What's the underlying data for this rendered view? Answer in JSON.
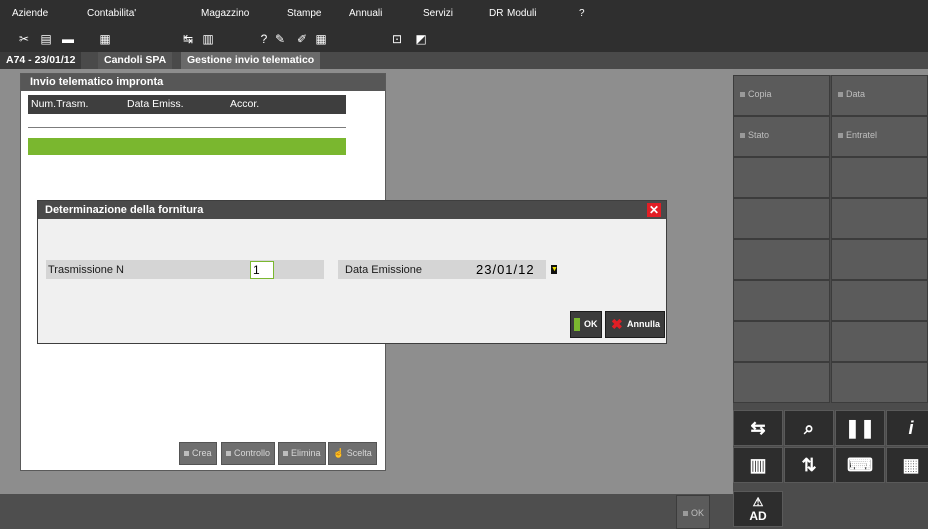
{
  "menu": {
    "items": [
      "Aziende",
      "Contabilita'",
      "Magazzino",
      "Stampe",
      "Annuali",
      "Servizi",
      "DR",
      "Moduli",
      "?"
    ]
  },
  "toolbar": {
    "icons": [
      "scissors-icon",
      "document-icon",
      "folder-icon",
      "printer-icon",
      "transfer-icon",
      "calendar-icon",
      "help-icon",
      "link-icon",
      "pencil-icon",
      "calculator-icon",
      "select-icon",
      "frame-icon"
    ]
  },
  "tabs": {
    "context": "A74 - 23/01/12",
    "company": "Candoli SPA",
    "module": "Gestione invio telematico"
  },
  "left_window": {
    "title": "Invio telematico impronta",
    "columns": [
      "Num.Trasm.",
      "Data Emiss.",
      "Accor."
    ],
    "actions": [
      "Crea",
      "Controllo",
      "Elimina",
      "Scelta"
    ]
  },
  "dialog": {
    "title": "Determinazione della fornitura",
    "trasmissione_label": "Trasmissione N",
    "trasmissione_value": "1",
    "data_label": "Data Emissione",
    "data_value": "23/01/12",
    "ok_label": "OK",
    "cancel_label": "Annulla"
  },
  "side_panel": {
    "buttons": [
      "Copia",
      "Data",
      "Stato",
      "Entratel"
    ],
    "icon_buttons": [
      "transfer-icon",
      "search-document-icon",
      "pause-icon",
      "info-icon",
      "barcode-icon",
      "export-icon",
      "keyboard-icon",
      "grid-icon"
    ],
    "ad_label": "AD"
  },
  "bottom": {
    "ok_label": "OK"
  },
  "colors": {
    "accent_green": "#7ab72f",
    "close_red": "#e21e25",
    "dark_panel": "#4c4c4c"
  }
}
